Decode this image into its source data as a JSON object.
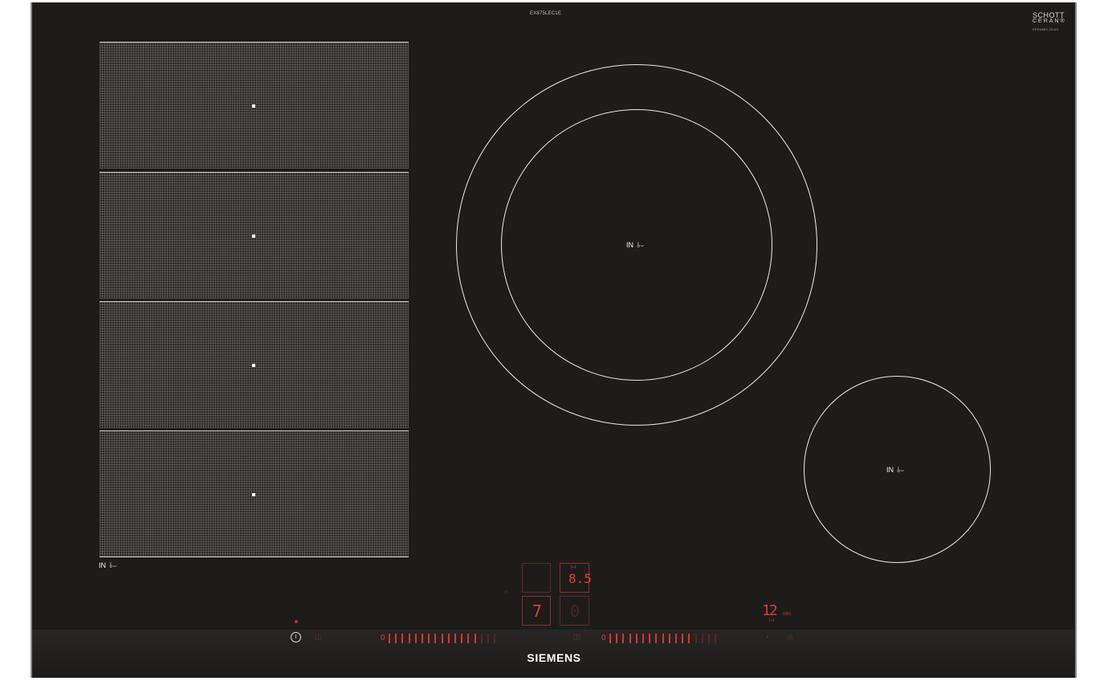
{
  "cooktop": {
    "model_code": "EX875LEC1E",
    "glass_brand": {
      "line1": "SCHOTT",
      "line2": "CERAN®",
      "line3": "KERAMIK-GLAS"
    },
    "brand": "SIEMENS",
    "induction_label": "IN",
    "induction_symbol": "⫰⌣",
    "flex_zones": [
      {
        "name": "flex-zone-1"
      },
      {
        "name": "flex-zone-2"
      },
      {
        "name": "flex-zone-3"
      },
      {
        "name": "flex-zone-4"
      }
    ]
  },
  "controls": {
    "power_symbol": "ⓘ",
    "slider_zero": "0",
    "slider_1_active_level": 14,
    "slider_2_active_level": 13,
    "slider_total_steps": 17,
    "display_left_top": "",
    "display_left_bottom": "7",
    "display_right_top": "8.5",
    "display_right_top_icon": "I–I",
    "display_right_bottom": "0",
    "timer_value": "12",
    "timer_unit": "min",
    "timer_icon": "I–I",
    "side_mark": "≡"
  },
  "colors": {
    "glass": "#1e1c1b",
    "ring": "#e9e9e9",
    "led_red": "#e53b2c",
    "led_dim": "#5e2420"
  }
}
